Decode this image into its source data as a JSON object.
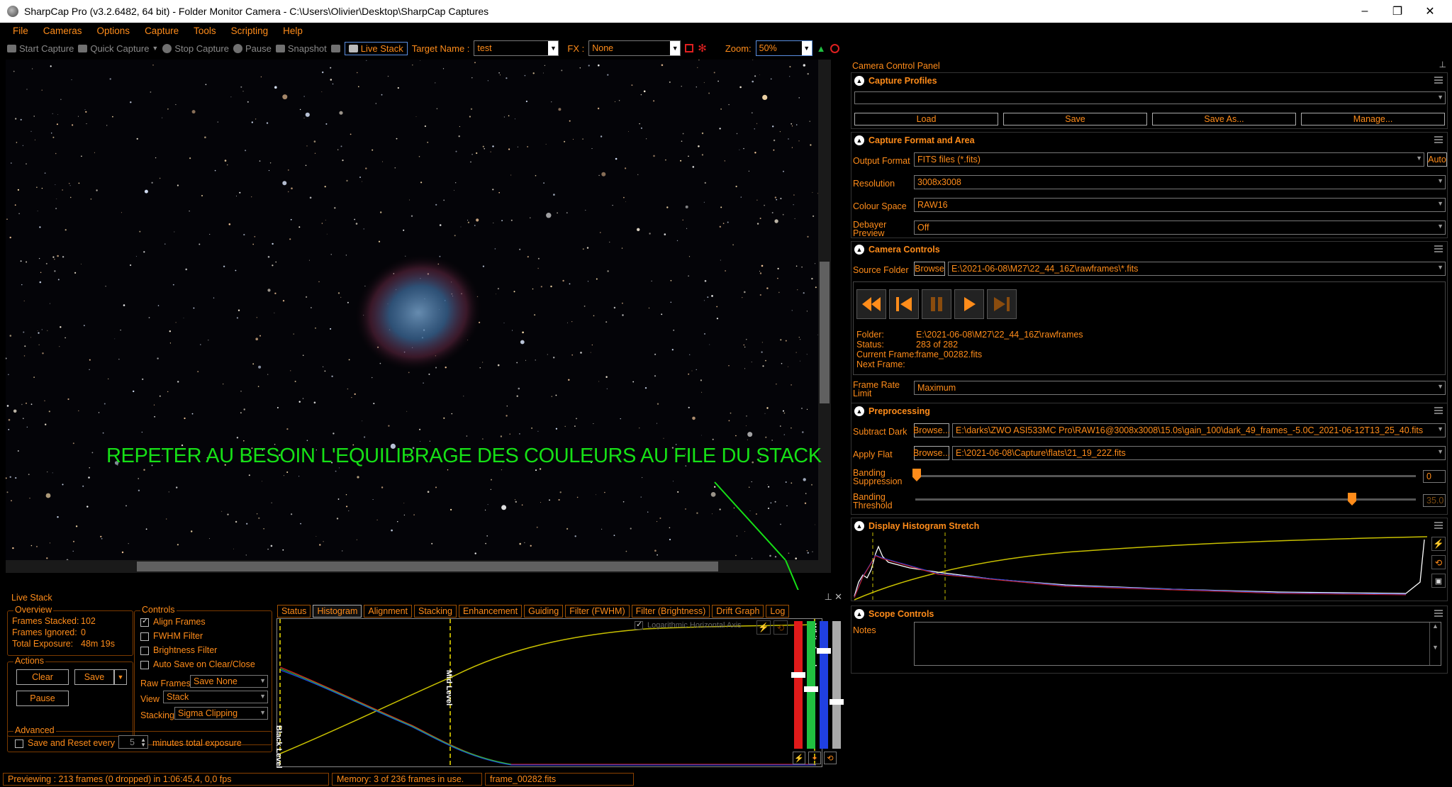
{
  "window": {
    "title": "SharpCap Pro (v3.2.6482, 64 bit) - Folder Monitor Camera - C:\\Users\\Olivier\\Desktop\\SharpCap Captures",
    "minimize": "–",
    "maximize": "❐",
    "close": "✕"
  },
  "menu": [
    "File",
    "Cameras",
    "Options",
    "Capture",
    "Tools",
    "Scripting",
    "Help"
  ],
  "toolbar": {
    "start_capture": "Start Capture",
    "quick_capture": "Quick Capture",
    "stop_capture": "Stop Capture",
    "pause": "Pause",
    "snapshot": "Snapshot",
    "live_stack": "Live Stack",
    "target_name_label": "Target Name :",
    "target_name_value": "test",
    "fx_label": "FX :",
    "fx_value": "None",
    "zoom_label": "Zoom:",
    "zoom_value": "50%"
  },
  "overlay_text": "REPETER AU BESOIN L'EQUILIBRAGE DES COULEURS AU FILE DU STACK",
  "live_stack": {
    "title": "Live Stack",
    "overview": {
      "title": "Overview",
      "frames_stacked_label": "Frames Stacked:",
      "frames_stacked": "102",
      "frames_ignored_label": "Frames Ignored:",
      "frames_ignored": "0",
      "total_exposure_label": "Total Exposure:",
      "total_exposure": "48m 19s"
    },
    "actions": {
      "title": "Actions",
      "clear": "Clear",
      "save": "Save",
      "pause": "Pause"
    },
    "controls": {
      "title": "Controls",
      "align_frames": "Align Frames",
      "fwhm_filter": "FWHM Filter",
      "brightness_filter": "Brightness Filter",
      "auto_save": "Auto Save on Clear/Close",
      "raw_frames_label": "Raw Frames",
      "raw_frames_value": "Save None",
      "view_label": "View",
      "view_value": "Stack",
      "stacking_label": "Stacking",
      "stacking_value": "Sigma Clipping"
    },
    "advanced": {
      "title": "Advanced",
      "save_reset_label": "Save and Reset every",
      "save_reset_value": "5",
      "save_reset_suffix": "minutes total exposure"
    },
    "tabs": [
      "Status",
      "Histogram",
      "Alignment",
      "Stacking",
      "Enhancement",
      "Guiding",
      "Filter (FWHM)",
      "Filter (Brightness)",
      "Drift Graph",
      "Log"
    ],
    "histogram": {
      "log_axis_label": "Logarithmic Horizontal Axis",
      "black_level": "Black Level",
      "mid_level": "Mid Level",
      "white_level": "White Level"
    }
  },
  "camera_panel": {
    "title": "Camera Control Panel",
    "capture_profiles": {
      "title": "Capture Profiles",
      "load": "Load",
      "save": "Save",
      "save_as": "Save As...",
      "manage": "Manage..."
    },
    "capture_format": {
      "title": "Capture Format and Area",
      "output_format_label": "Output Format",
      "output_format_value": "FITS files (*.fits)",
      "auto": "Auto",
      "resolution_label": "Resolution",
      "resolution_value": "3008x3008",
      "colour_space_label": "Colour Space",
      "colour_space_value": "RAW16",
      "debayer_label_1": "Debayer",
      "debayer_label_2": "Preview",
      "debayer_value": "Off"
    },
    "camera_controls": {
      "title": "Camera Controls",
      "source_folder_label": "Source Folder",
      "browse": "Browse",
      "source_folder_value": "E:\\2021-06-08\\M27\\22_44_16Z\\rawframes\\*.fits",
      "folder_label": "Folder:",
      "folder_value": "E:\\2021-06-08\\M27\\22_44_16Z\\rawframes",
      "status_label": "Status:",
      "status_value": "283 of 282",
      "current_frame_label": "Current Frame:",
      "current_frame_value": "frame_00282.fits",
      "next_frame_label": "Next Frame:",
      "next_frame_value": "",
      "frame_rate_label_1": "Frame Rate",
      "frame_rate_label_2": "Limit",
      "frame_rate_value": "Maximum"
    },
    "preprocessing": {
      "title": "Preprocessing",
      "subtract_dark_label": "Subtract Dark",
      "browse": "Browse...",
      "subtract_dark_value": "E:\\darks\\ZWO ASI533MC Pro\\RAW16@3008x3008\\15.0s\\gain_100\\dark_49_frames_-5.0C_2021-06-12T13_25_40.fits",
      "apply_flat_label": "Apply Flat",
      "apply_flat_value": "E:\\2021-06-08\\Capture\\flats\\21_19_22Z.fits",
      "banding_suppression_label_1": "Banding",
      "banding_suppression_label_2": "Suppression",
      "banding_suppression_value": "0",
      "banding_threshold_label_1": "Banding",
      "banding_threshold_label_2": "Threshold",
      "banding_threshold_value": "35.0"
    },
    "display_histogram": {
      "title": "Display Histogram Stretch"
    },
    "scope_controls": {
      "title": "Scope Controls",
      "notes_label": "Notes"
    }
  },
  "status": {
    "previewing": "Previewing : 213 frames (0 dropped) in 1:06:45,4, 0,0 fps",
    "memory": "Memory: 3 of 236 frames in use.",
    "frame": "frame_00282.fits"
  }
}
